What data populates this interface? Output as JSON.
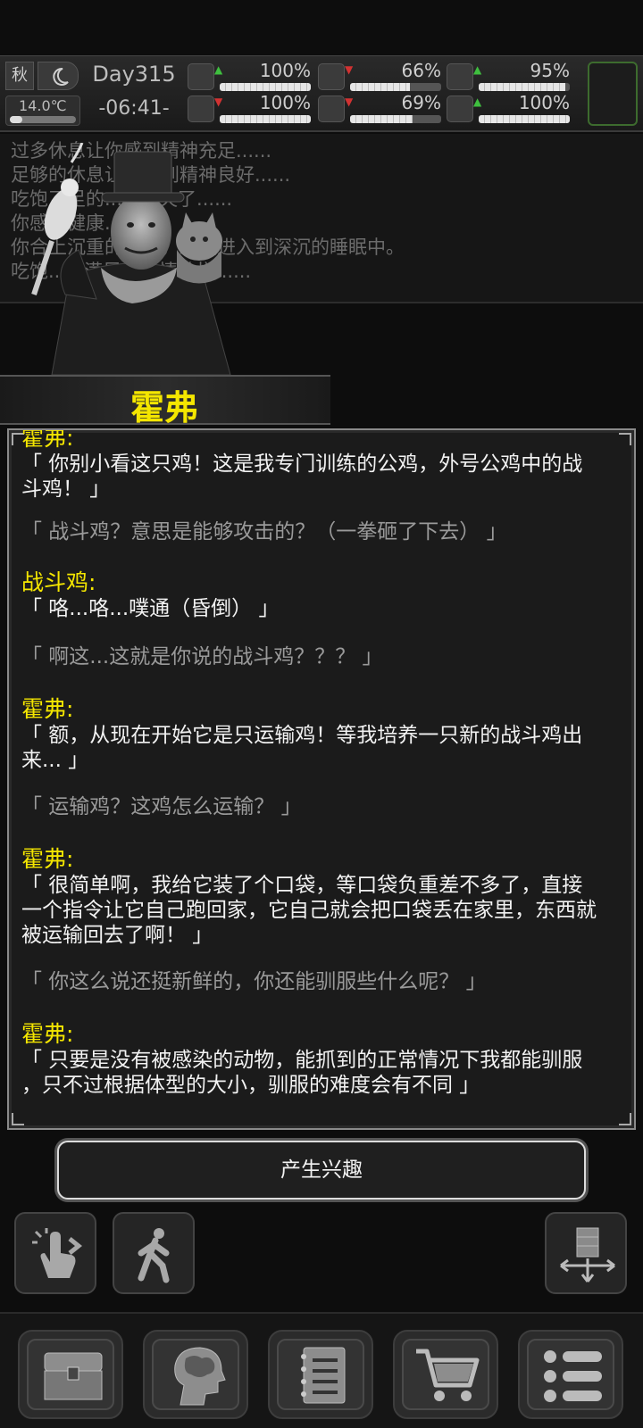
{
  "status": {
    "season": "秋",
    "temperature": "14.0℃",
    "day": "Day315",
    "time": "-06:41-",
    "stats": [
      {
        "name": "health",
        "icon": "medkit-icon",
        "trend": "up",
        "value": "100%",
        "level": 1.0
      },
      {
        "name": "stamina",
        "icon": "stomach-icon",
        "trend": "down",
        "value": "66%",
        "level": 0.66
      },
      {
        "name": "mood",
        "icon": "face-icon",
        "trend": "up",
        "value": "95%",
        "level": 0.95
      },
      {
        "name": "legs",
        "icon": "leg-icon",
        "trend": "down",
        "value": "100%",
        "level": 1.0
      },
      {
        "name": "water",
        "icon": "water-drop-icon",
        "trend": "down",
        "value": "69%",
        "level": 0.69
      },
      {
        "name": "heart",
        "icon": "heart-icon",
        "trend": "up",
        "value": "100%",
        "level": 1.0
      }
    ]
  },
  "log": [
    "过多休息让你感到精神充足......",
    "足够的休息让你感到精神良好......",
    "吃饱了足的......消失了......",
    "你感到健康......",
    "你合上沉重的双眼，缓缓进入到深沉的睡眠中。",
    "吃饱......满足，心情愉悦......"
  ],
  "speaker_name": "霍弗",
  "dialog": [
    {
      "speaker": "霍弗:",
      "lines": [
        "「 你别小看这只鸡！这是我专门训练的公鸡，外号公鸡中的战",
        "斗鸡！ 」"
      ]
    },
    {
      "reply": "「 战斗鸡？意思是能够攻击的？（一拳砸了下去） 」"
    },
    {
      "speaker": "战斗鸡:",
      "lines": [
        "「 咯...咯...噗通（昏倒） 」"
      ]
    },
    {
      "reply": "「 啊这...这就是你说的战斗鸡？？？ 」"
    },
    {
      "speaker": "霍弗:",
      "lines": [
        "「 额，从现在开始它是只运输鸡！等我培养一只新的战斗鸡出",
        "来... 」"
      ]
    },
    {
      "reply": "「 运输鸡？这鸡怎么运输？ 」"
    },
    {
      "speaker": "霍弗:",
      "lines": [
        "「 很简单啊，我给它装了个口袋，等口袋负重差不多了，直接",
        "一个指令让它自己跑回家，它自己就会把口袋丢在家里，东西就",
        "被运输回去了啊！ 」"
      ]
    },
    {
      "reply": "「 你这么说还挺新鲜的，你还能驯服些什么呢？ 」"
    },
    {
      "speaker": "霍弗:",
      "lines": [
        "「 只要是没有被感染的动物，能抓到的正常情况下我都能驯服",
        "，只不过根据体型的大小，驯服的难度会有不同 」"
      ]
    }
  ],
  "action_button": "产生兴趣",
  "tools": [
    {
      "name": "interact-icon"
    },
    {
      "name": "walk-icon"
    },
    {
      "name": "storage-icon"
    }
  ],
  "nav": [
    {
      "name": "chest-icon"
    },
    {
      "name": "brain-icon"
    },
    {
      "name": "journal-icon"
    },
    {
      "name": "cart-icon"
    },
    {
      "name": "menu-icon"
    }
  ],
  "colors": {
    "speaker": "#f4e600",
    "reply": "#9a9a9a",
    "speech": "#f2f2f2"
  }
}
